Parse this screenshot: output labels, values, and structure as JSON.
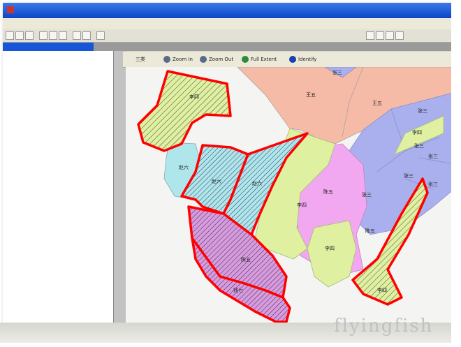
{
  "window": {
    "title": "",
    "mdi_title": "",
    "menu": [
      "",
      "",
      "",
      "",
      "",
      "",
      "",
      "",
      "",
      ""
    ]
  },
  "tree": {
    "items": [
      "",
      ""
    ]
  },
  "map_toolbar": {
    "items": [
      "三类",
      "Zoom In",
      "Zoom Out",
      "Full Extent",
      "Identify"
    ]
  },
  "map": {
    "labels": {
      "wangwu_1": "王五",
      "wangwu_2": "王五",
      "zhang_top": "张三",
      "zhangsan_1": "张三",
      "zhangsan_2": "张三",
      "zhangsan_3": "张三",
      "zhangsan_4": "张三",
      "zhangsan_5": "张三",
      "zhangsan_6": "张三",
      "lisi_top": "李四",
      "lisi_1": "李四",
      "lisi_2": "李四",
      "lisi_3": "李四",
      "lisi_4": "李四",
      "zhaoliu_1": "赵六",
      "zhaoliu_2": "赵六",
      "zhaoliu_3": "赵六",
      "chenwu_1": "陈五",
      "chenwu_2": "陈五",
      "chenqi": "陈五",
      "qianqi": "钱七"
    },
    "colors": {
      "wangwu": "#f5bba6",
      "zhangsan": "#aab0ee",
      "lisi": "#dff0a0",
      "zhaoliu": "#aee6ec",
      "chenwu": "#f2a8f0",
      "purple": "#d89ae0",
      "selection": "#ff0000"
    }
  },
  "watermark": "flyingfish"
}
